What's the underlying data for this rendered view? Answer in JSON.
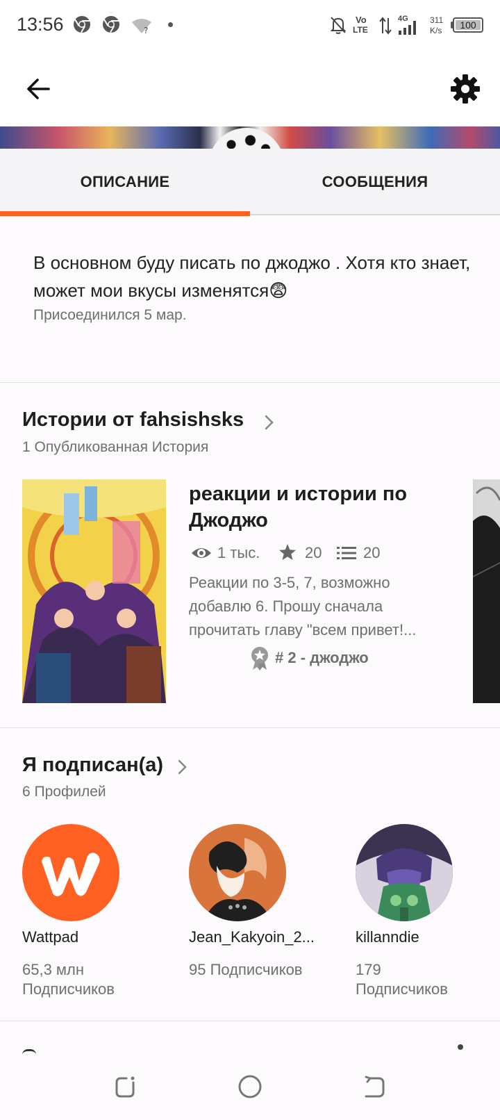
{
  "status_bar": {
    "time": "13:56",
    "volte_top": "Vo",
    "volte_bottom": "LTE",
    "network": "4G",
    "speed_value": "311",
    "speed_unit": "K/s",
    "battery": "100",
    "icons": [
      "chrome-icon",
      "chrome-icon",
      "wifi-question-icon",
      "dot-icon",
      "bell-off-icon",
      "volte-icon",
      "data-arrows-icon",
      "signal-icon",
      "battery-icon"
    ]
  },
  "app_bar": {
    "back_icon": "arrow-left-icon",
    "settings_icon": "gear-icon"
  },
  "tabs": [
    {
      "label": "ОПИСАНИЕ",
      "active": true
    },
    {
      "label": "СООБЩЕНИЯ",
      "active": false
    }
  ],
  "accent_color": "#ff6122",
  "about": {
    "description": "В основном буду писать по джоджо . Хотя кто знает, может мои вкусы изменятся😨",
    "joined": "Присоединился 5 мар."
  },
  "stories": {
    "title": "Истории от fahsishsks",
    "subtitle": "1 Опубликованная История",
    "items": [
      {
        "title": "реакции и истории по Джоджо",
        "reads": "1 тыс.",
        "votes": "20",
        "parts": "20",
        "description": "Реакции по 3-5, 7, возможно добавлю 6. Прошу сначала прочитать главу \"всем привет!...",
        "rank": "# 2 - джоджо"
      }
    ]
  },
  "following": {
    "title": "Я подписан(а)",
    "subtitle": "6 Профилей",
    "profiles": [
      {
        "name": "Wattpad",
        "followers_line1": "65,3 млн",
        "followers_line2": "Подписчиков"
      },
      {
        "name": "Jean_Kakyoin_2...",
        "followers_line1": "95 Подписчиков",
        "followers_line2": ""
      },
      {
        "name": "killanndie",
        "followers_line1": "179",
        "followers_line2": "Подписчиков"
      }
    ]
  },
  "nav_bar": {
    "icons": [
      "recent-apps-icon",
      "home-icon",
      "back-nav-icon"
    ]
  }
}
